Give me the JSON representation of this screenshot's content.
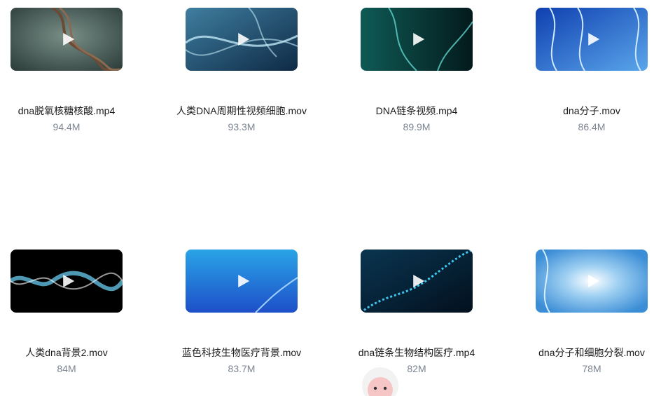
{
  "videos": [
    {
      "filename": "dna脱氧核糖核酸.mp4",
      "size": "94.4M",
      "thumb_colors": [
        "#2e3f3c",
        "#7a8f88"
      ],
      "strand_color": "#6b4a36"
    },
    {
      "filename": "人类DNA周期性视频细胞.mov",
      "size": "93.3M",
      "thumb_colors": [
        "#0e2a45",
        "#3f7ea0"
      ],
      "strand_color": "#bfe6f5"
    },
    {
      "filename": "DNA链条视频.mp4",
      "size": "89.9M",
      "thumb_colors": [
        "#031a1c",
        "#0f5a55"
      ],
      "strand_color": "#5fd6cf"
    },
    {
      "filename": "dna分子.mov",
      "size": "86.4M",
      "thumb_colors": [
        "#0f3fb0",
        "#5aa6ea"
      ],
      "strand_color": "#cfe9ff"
    },
    {
      "filename": "人类dna背景2.mov",
      "size": "84M",
      "thumb_colors": [
        "#000000",
        "#031014"
      ],
      "strand_color": "#6fd8ff"
    },
    {
      "filename": "蓝色科技生物医疗背景.mov",
      "size": "83.7M",
      "thumb_colors": [
        "#2aa4e6",
        "#1d4fc9"
      ],
      "strand_color": "#9fd0ff"
    },
    {
      "filename": "dna链条生物结构医疗.mp4",
      "size": "82M",
      "thumb_colors": [
        "#02101e",
        "#0a3550"
      ],
      "strand_color": "#3fc6f0"
    },
    {
      "filename": "dna分子和细胞分裂.mov",
      "size": "78M",
      "thumb_colors": [
        "#3b8dd6",
        "#9fd0f2"
      ],
      "strand_color": "#d8eeff"
    }
  ],
  "icons": {
    "play": "play-icon",
    "mascot": "sheep-mascot-icon"
  }
}
